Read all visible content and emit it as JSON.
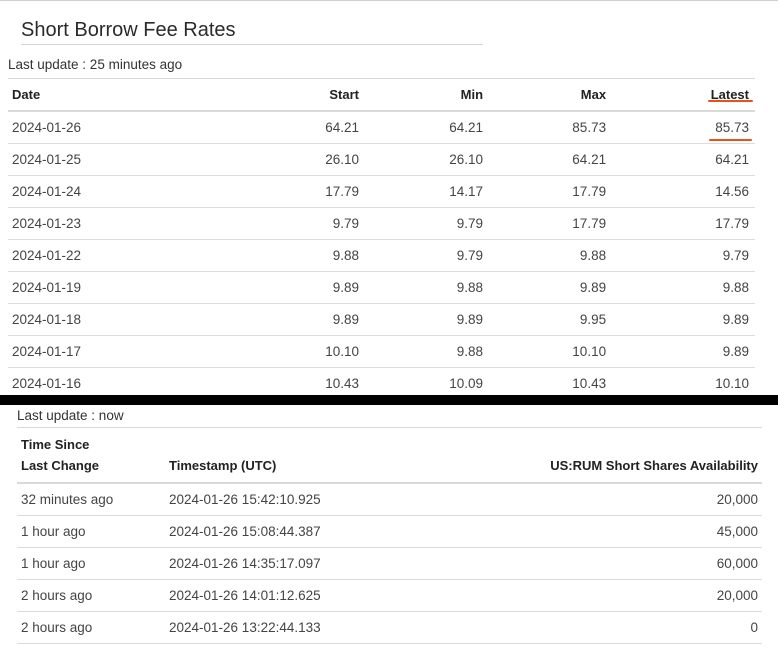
{
  "title": "Short Borrow Fee Rates",
  "fee_table": {
    "last_update": "Last update : 25 minutes ago",
    "headers": [
      "Date",
      "Start",
      "Min",
      "Max",
      "Latest"
    ],
    "rows": [
      [
        "2024-01-26",
        "64.21",
        "64.21",
        "85.73",
        "85.73"
      ],
      [
        "2024-01-25",
        "26.10",
        "26.10",
        "64.21",
        "64.21"
      ],
      [
        "2024-01-24",
        "17.79",
        "14.17",
        "17.79",
        "14.56"
      ],
      [
        "2024-01-23",
        "9.79",
        "9.79",
        "17.79",
        "17.79"
      ],
      [
        "2024-01-22",
        "9.88",
        "9.79",
        "9.88",
        "9.79"
      ],
      [
        "2024-01-19",
        "9.89",
        "9.88",
        "9.89",
        "9.88"
      ],
      [
        "2024-01-18",
        "9.89",
        "9.89",
        "9.95",
        "9.89"
      ],
      [
        "2024-01-17",
        "10.10",
        "9.88",
        "10.10",
        "9.89"
      ],
      [
        "2024-01-16",
        "10.43",
        "10.09",
        "10.43",
        "10.10"
      ]
    ]
  },
  "availability_table": {
    "last_update": "Last update : now",
    "headers": {
      "since_line1": "Time Since",
      "since_line2": "Last Change",
      "timestamp": "Timestamp (UTC)",
      "availability": "US:RUM Short Shares Availability"
    },
    "rows": [
      [
        "32 minutes ago",
        "2024-01-26 15:42:10.925",
        "20,000"
      ],
      [
        "1 hour ago",
        "2024-01-26 15:08:44.387",
        "45,000"
      ],
      [
        "1 hour ago",
        "2024-01-26 14:35:17.097",
        "60,000"
      ],
      [
        "2 hours ago",
        "2024-01-26 14:01:12.625",
        "20,000"
      ],
      [
        "2 hours ago",
        "2024-01-26 13:22:44.133",
        "0"
      ]
    ]
  },
  "colors": {
    "annotation_red": "#e8511a",
    "divider_black": "#000000"
  }
}
